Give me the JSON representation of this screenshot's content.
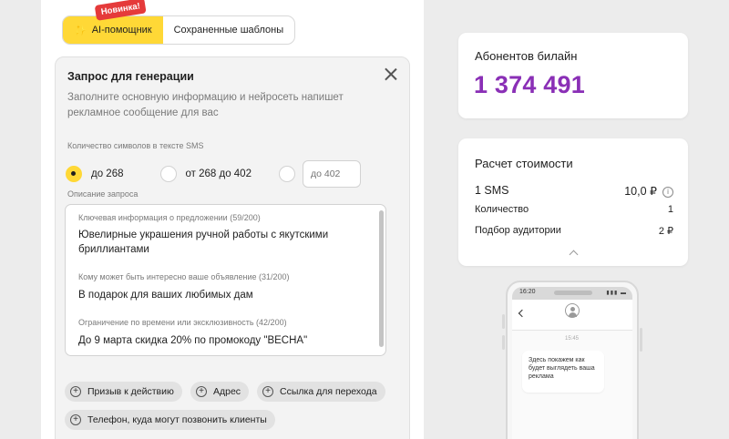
{
  "tabs": {
    "ai_label": "AI-помощник",
    "saved_label": "Сохраненные шаблоны",
    "new_badge": "Новинка!"
  },
  "form": {
    "title": "Запрос для генерации",
    "description": "Заполните основную информацию и нейросеть напишет рекламное сообщение для вас",
    "length_label": "Количество символов в тексте SMS",
    "length_options": [
      "до 268",
      "от 268 до 402"
    ],
    "selected_length": "до 268",
    "custom_length_placeholder": "до 402",
    "request_label": "Описание запроса",
    "fields": [
      {
        "label": "Ключевая информация о предложении (59/200)",
        "value": "Ювелирные украшения ручной работы с якутскими бриллиантами"
      },
      {
        "label": "Кому может быть интересно ваше объявление (31/200)",
        "value": "В подарок для ваших любимых дам"
      },
      {
        "label": "Ограничение по времени или эксклюзивность (42/200)",
        "value": "До 9 марта скидка 20% по промокоду \"ВЕСНА\""
      }
    ],
    "chips": [
      "Призыв к действию",
      "Адрес",
      "Ссылка для перехода",
      "Телефон, куда могут позвонить клиенты"
    ]
  },
  "subscribers": {
    "title": "Абонентов билайн",
    "count": "1 374 491"
  },
  "cost": {
    "title": "Расчет стоимости",
    "rows": [
      {
        "label": "1 SMS",
        "value": "10,0 ₽"
      },
      {
        "label": "Количество",
        "value": "1"
      },
      {
        "label": "Подбор аудитории",
        "value": "2 ₽"
      }
    ]
  },
  "phone": {
    "time": "16:20",
    "message_time": "15:45",
    "message": "Здесь покажем как будет выглядеть ваша реклама"
  },
  "colors": {
    "accent_yellow": "#ffd836",
    "brand_purple": "#8a2fb6",
    "badge_red": "#e53a3a"
  }
}
